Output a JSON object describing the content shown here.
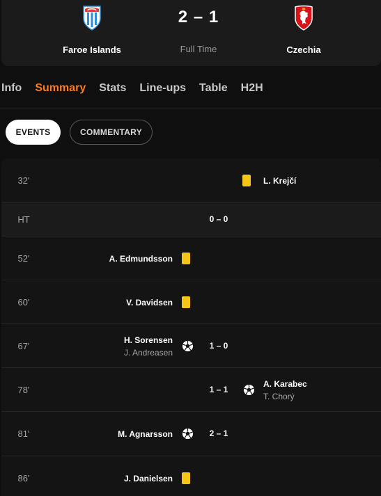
{
  "match": {
    "home_team": "Faroe Islands",
    "away_team": "Czechia",
    "score": "2 – 1",
    "status": "Full Time"
  },
  "tabs": [
    {
      "label": "Info",
      "active": false
    },
    {
      "label": "Summary",
      "active": true
    },
    {
      "label": "Stats",
      "active": false
    },
    {
      "label": "Line-ups",
      "active": false
    },
    {
      "label": "Table",
      "active": false
    },
    {
      "label": "H2H",
      "active": false
    }
  ],
  "toggles": {
    "events": "EVENTS",
    "commentary": "COMMENTARY",
    "selected": "events"
  },
  "events": [
    {
      "minute": "32'",
      "side": "away",
      "type": "yellow-card",
      "player": "L. Krejčí"
    },
    {
      "minute": "HT",
      "type": "half-time",
      "score": "0 – 0"
    },
    {
      "minute": "52'",
      "side": "home",
      "type": "yellow-card",
      "player": "A. Edmundsson"
    },
    {
      "minute": "60'",
      "side": "home",
      "type": "yellow-card",
      "player": "V. Davidsen"
    },
    {
      "minute": "67'",
      "side": "home",
      "type": "goal",
      "player": "H. Sorensen",
      "assist": "J. Andreasen",
      "score": "1 – 0"
    },
    {
      "minute": "78'",
      "side": "away",
      "type": "goal",
      "player": "A. Karabec",
      "assist": "T. Chorý",
      "score": "1 – 1"
    },
    {
      "minute": "81'",
      "side": "home",
      "type": "goal",
      "player": "M. Agnarsson",
      "score": "2 – 1"
    },
    {
      "minute": "86'",
      "side": "home",
      "type": "yellow-card",
      "player": "J. Danielsen"
    }
  ],
  "colors": {
    "accent": "#ff7a1a",
    "yellow_card": "#f5c518",
    "background": "#0f0f0f"
  },
  "icons": {
    "home_crest": "faroe-islands-crest-icon",
    "away_crest": "czechia-crest-icon",
    "goal": "football-icon",
    "yellow_card": "yellow-card-icon"
  }
}
